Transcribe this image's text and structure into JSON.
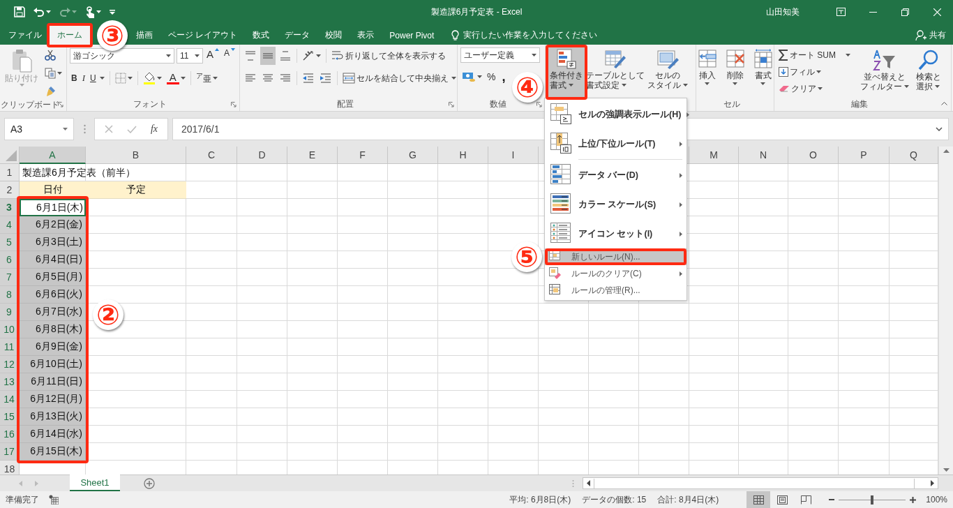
{
  "window": {
    "title": "製造課6月予定表 - Excel",
    "user": "山田知美"
  },
  "ribbon_tabs": [
    {
      "label": "ファイル",
      "selected": false
    },
    {
      "label": "ホーム",
      "selected": true
    },
    {
      "label": "描画",
      "selected": false
    },
    {
      "label": "ページ レイアウト",
      "selected": false
    },
    {
      "label": "数式",
      "selected": false
    },
    {
      "label": "データ",
      "selected": false
    },
    {
      "label": "校閲",
      "selected": false
    },
    {
      "label": "表示",
      "selected": false
    },
    {
      "label": "Power Pivot",
      "selected": false
    }
  ],
  "tell_me": {
    "placeholder": "実行したい作業を入力してください"
  },
  "share": "共有",
  "ribbon": {
    "clipboard": {
      "paste": "貼り付け",
      "paste_disabled": true,
      "label": "クリップボード"
    },
    "font": {
      "name": "游ゴシック",
      "size": "11",
      "grow": "A",
      "shrink": "A",
      "bold": "B",
      "italic": "I",
      "underline": "U",
      "font_color": "A",
      "phonetic": "$^{ア}$亜",
      "label": "フォント"
    },
    "alignment": {
      "vertical": [
        {
          "kind": "top",
          "selected": false
        },
        {
          "kind": "middle",
          "selected": true
        },
        {
          "kind": "bottom",
          "selected": false
        }
      ],
      "horizontal": [
        {
          "kind": "left",
          "selected": false
        },
        {
          "kind": "center",
          "selected": false
        },
        {
          "kind": "right",
          "selected": false
        }
      ],
      "wrap": "折り返して全体を表示する",
      "merge": "セルを結合して中央揃え",
      "label": "配置"
    },
    "number": {
      "format": "ユーザー定義",
      "percent": "%",
      "comma": ",",
      "label": "数値"
    },
    "styles": [
      {
        "lines": [
          "条件付き",
          "書式"
        ],
        "selected": true
      },
      {
        "lines": [
          "テーブルとして",
          "書式設定"
        ],
        "selected": false
      },
      {
        "lines": [
          "セルの",
          "スタイル"
        ],
        "selected": false
      }
    ],
    "cells": {
      "buttons": [
        "挿入",
        "削除",
        "書式"
      ],
      "label": "セル"
    },
    "editing": {
      "autosum": "オート SUM",
      "fill": "フィル",
      "clear": "クリア",
      "sort": [
        "並べ替えと",
        "フィルター"
      ],
      "find": [
        "検索と",
        "選択"
      ],
      "label": "編集"
    }
  },
  "formula_bar": {
    "name_box": "A3",
    "fx": "fx",
    "value": "2017/6/1"
  },
  "columns": [
    {
      "label": "A",
      "selected": true
    },
    {
      "label": "B",
      "selected": false
    },
    {
      "label": "C",
      "selected": false
    },
    {
      "label": "D",
      "selected": false
    },
    {
      "label": "E",
      "selected": false
    },
    {
      "label": "F",
      "selected": false
    },
    {
      "label": "G",
      "selected": false
    },
    {
      "label": "H",
      "selected": false
    },
    {
      "label": "I",
      "selected": false
    },
    {
      "label": "M",
      "selected": false
    },
    {
      "label": "N",
      "selected": false
    },
    {
      "label": "O",
      "selected": false
    },
    {
      "label": "P",
      "selected": false
    },
    {
      "label": "Q",
      "selected": false
    }
  ],
  "rows": [
    {
      "label": "1",
      "kind": "title",
      "selected": false,
      "active": false,
      "cells": [
        "製造課6月予定表（前半）"
      ]
    },
    {
      "label": "2",
      "kind": "header",
      "selected": false,
      "active": false,
      "cells": [
        "日付",
        "予定"
      ]
    },
    {
      "label": "3",
      "kind": "date",
      "selected": true,
      "active": true,
      "cells": [
        "6月1日(木)"
      ]
    },
    {
      "label": "4",
      "kind": "date",
      "selected": true,
      "active": false,
      "cells": [
        "6月2日(金)"
      ]
    },
    {
      "label": "5",
      "kind": "date",
      "selected": true,
      "active": false,
      "cells": [
        "6月3日(土)"
      ]
    },
    {
      "label": "6",
      "kind": "date",
      "selected": true,
      "active": false,
      "cells": [
        "6月4日(日)"
      ]
    },
    {
      "label": "7",
      "kind": "date",
      "selected": true,
      "active": false,
      "cells": [
        "6月5日(月)"
      ]
    },
    {
      "label": "8",
      "kind": "date",
      "selected": true,
      "active": false,
      "cells": [
        "6月6日(火)"
      ]
    },
    {
      "label": "9",
      "kind": "date",
      "selected": true,
      "active": false,
      "cells": [
        "6月7日(水)"
      ]
    },
    {
      "label": "10",
      "kind": "date",
      "selected": true,
      "active": false,
      "cells": [
        "6月8日(木)"
      ]
    },
    {
      "label": "11",
      "kind": "date",
      "selected": true,
      "active": false,
      "cells": [
        "6月9日(金)"
      ]
    },
    {
      "label": "12",
      "kind": "date",
      "selected": true,
      "active": false,
      "cells": [
        "6月10日(土)"
      ]
    },
    {
      "label": "13",
      "kind": "date",
      "selected": true,
      "active": false,
      "cells": [
        "6月11日(日)"
      ]
    },
    {
      "label": "14",
      "kind": "date",
      "selected": true,
      "active": false,
      "cells": [
        "6月12日(月)"
      ]
    },
    {
      "label": "15",
      "kind": "date",
      "selected": true,
      "active": false,
      "cells": [
        "6月13日(火)"
      ]
    },
    {
      "label": "16",
      "kind": "date",
      "selected": true,
      "active": false,
      "cells": [
        "6月14日(水)"
      ]
    },
    {
      "label": "17",
      "kind": "date",
      "selected": true,
      "active": false,
      "cells": [
        "6月15日(木)"
      ]
    },
    {
      "label": "18",
      "kind": "empty",
      "selected": false,
      "active": false
    }
  ],
  "menu": [
    {
      "kind": "large",
      "label": "セルの強調表示ルール(H)",
      "submenu": true,
      "selected": false
    },
    {
      "kind": "large",
      "label": "上位/下位ルール(T)",
      "submenu": true,
      "selected": false
    },
    {
      "kind": "separator"
    },
    {
      "kind": "large",
      "label": "データ バー(D)",
      "submenu": true,
      "selected": false
    },
    {
      "kind": "large",
      "label": "カラー スケール(S)",
      "submenu": true,
      "selected": false
    },
    {
      "kind": "large",
      "label": "アイコン セット(I)",
      "submenu": true,
      "selected": false
    },
    {
      "kind": "small",
      "label": "新しいルール(N)...",
      "submenu": false,
      "selected": true
    },
    {
      "kind": "small",
      "label": "ルールのクリア(C)",
      "submenu": true,
      "selected": false
    },
    {
      "kind": "small",
      "label": "ルールの管理(R)...",
      "submenu": false,
      "selected": false
    }
  ],
  "sheets": [
    {
      "label": "Sheet1",
      "selected": true
    }
  ],
  "status_bar": {
    "mode": "準備完了",
    "average": "平均: 6月8日(木)",
    "count": "データの個数: 15",
    "sum": "合計: 8月4日(木)",
    "views": [
      {
        "kind": "normal",
        "selected": true
      },
      {
        "kind": "page_layout",
        "selected": false
      },
      {
        "kind": "page_break",
        "selected": false
      }
    ],
    "zoom": {
      "level": 0.5,
      "reading": "100%"
    }
  },
  "annotations": [
    {
      "label": "②"
    },
    {
      "label": "③"
    },
    {
      "label": "④"
    },
    {
      "label": "⑤"
    }
  ]
}
